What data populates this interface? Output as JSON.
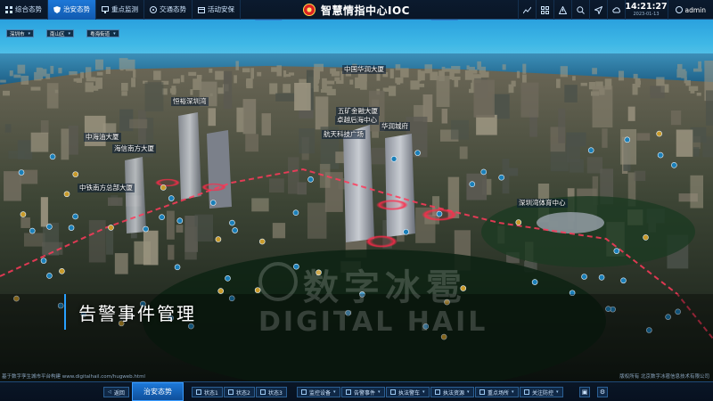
{
  "nav": {
    "tabs": [
      {
        "label": "综合态势",
        "icon": "grid-icon",
        "active": false
      },
      {
        "label": "治安态势",
        "icon": "shield-icon",
        "active": true
      },
      {
        "label": "重点监测",
        "icon": "monitor-icon",
        "active": false
      },
      {
        "label": "交通态势",
        "icon": "traffic-icon",
        "active": false
      },
      {
        "label": "活动安保",
        "icon": "event-icon",
        "active": false
      }
    ]
  },
  "header": {
    "title": "智慧情指中心IOC",
    "emblem": "police-emblem-icon"
  },
  "toolbar": {
    "icons": [
      "chart-icon",
      "grid-icon",
      "alert-icon",
      "search-icon",
      "send-icon",
      "weather-icon"
    ],
    "clock": {
      "time": "14:21:27",
      "date": "2023-01-13"
    },
    "user": "admin"
  },
  "filters": [
    {
      "value": "深圳市"
    },
    {
      "value": "南山区"
    },
    {
      "value": "粤海街道"
    }
  ],
  "map_labels": [
    "中国华润大厦",
    "恒裕深圳湾",
    "五矿金融大厦",
    "卓越后海中心",
    "华润城府",
    "航天科技广场",
    "中海油大厦",
    "海信南方大厦",
    "中铁南方总部大厦",
    "深圳湾体育中心"
  ],
  "panel_title": "告警事件管理",
  "watermark": {
    "cn": "数字冰雹",
    "en": "DIGITAL HAIL"
  },
  "footer": {
    "left": "基于数字孪生城市平台构建 www.digitalhail.com/hugweb.html",
    "right": "版权所有 北京数字冰雹信息技术有限公司"
  },
  "bottom": {
    "back": "返回",
    "active": "治安态势",
    "states": [
      "状态1",
      "状态2",
      "状态3"
    ],
    "menus": [
      "监控设备",
      "告警事件",
      "执法警车",
      "执法资源",
      "重点场所",
      "关注防控"
    ],
    "icons": [
      "layers-icon",
      "settings-icon"
    ]
  },
  "colors": {
    "accent": "#1d78d8",
    "alert": "#ff2a4a",
    "panel_bg": "#0a1626"
  }
}
